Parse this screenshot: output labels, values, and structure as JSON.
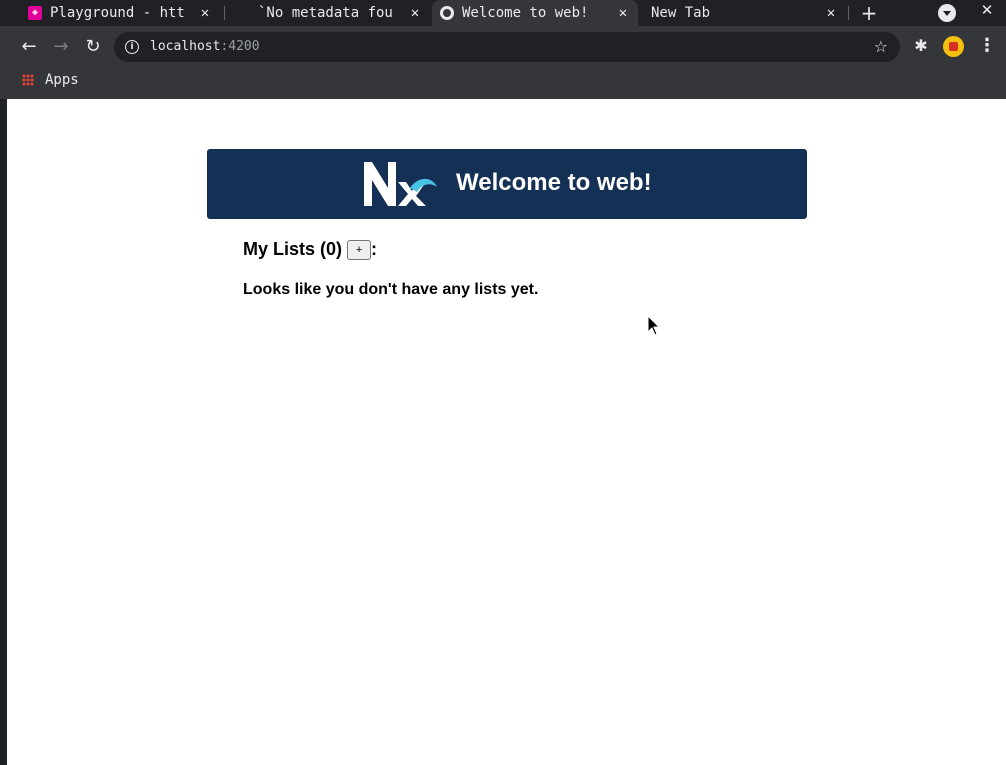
{
  "browser": {
    "tabs": [
      {
        "title": "Playground - htt",
        "close": "✕",
        "favicon": "graphql-playground-icon"
      },
      {
        "title": "`No metadata fou",
        "close": "✕",
        "favicon": "blank-page-icon"
      },
      {
        "title": "Welcome to web!",
        "close": "✕",
        "favicon": "globe-icon"
      },
      {
        "title": "New Tab",
        "close": "✕",
        "favicon": "none"
      }
    ],
    "new_tab": "+",
    "window_close": "✕",
    "address": {
      "host": "localhost",
      "port": ":4200"
    },
    "bookmarks": [
      {
        "label": "Apps"
      }
    ]
  },
  "page": {
    "header": {
      "title": "Welcome to web!"
    },
    "lists": {
      "heading": "My Lists (0)",
      "add_label": "+",
      "colon": ":",
      "empty_message": "Looks like you don't have any lists yet."
    }
  },
  "colors": {
    "hero_bg": "#143055",
    "accent": "#48c4e5"
  }
}
